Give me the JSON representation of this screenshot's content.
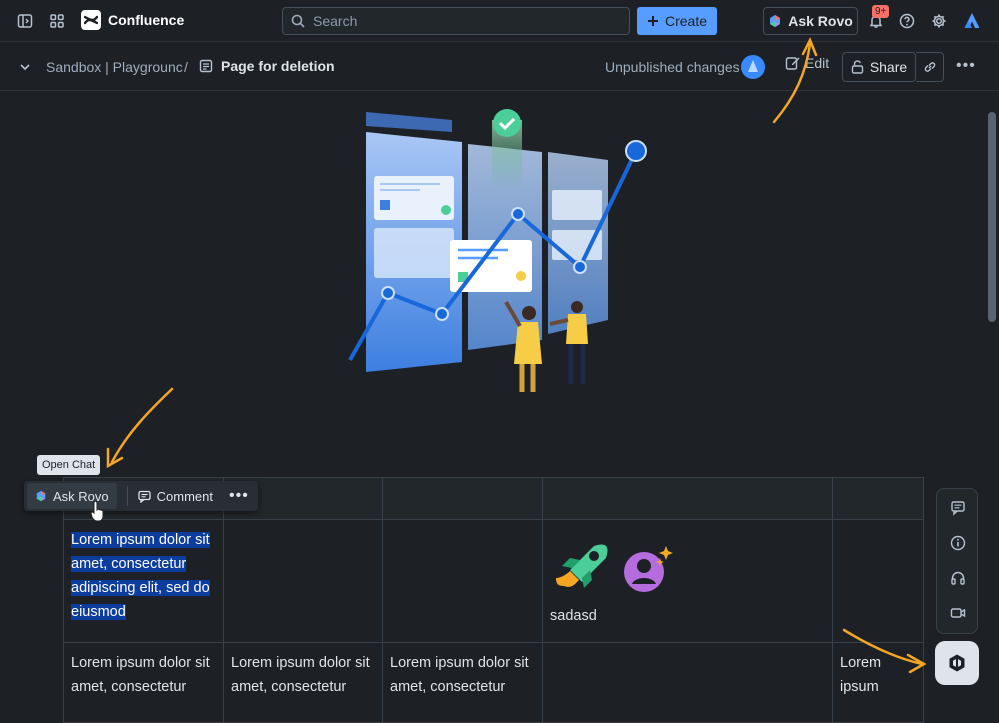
{
  "topbar": {
    "app_name": "Confluence",
    "search_placeholder": "Search",
    "create_label": "Create",
    "ask_rovo_label": "Ask Rovo",
    "notifications_badge": "9+"
  },
  "subbar": {
    "breadcrumb_space": "Sandbox | Playgrounc",
    "breadcrumb_sep": "/",
    "page_title": "Page for deletion",
    "status": "Unpublished changes",
    "edit_label": "Edit",
    "share_label": "Share"
  },
  "toolbar": {
    "tooltip": "Open Chat",
    "ask_rovo_label": "Ask Rovo",
    "comment_label": "Comment"
  },
  "table": {
    "row1": {
      "c1": "Lorem ipsum dolor sit amet, consectetur adipiscing elit, sed do eiusmod",
      "c4": "sadasd"
    },
    "row2": {
      "c1": "Lorem ipsum dolor sit amet, consectetur",
      "c2": "Lorem ipsum dolor sit amet, consectetur",
      "c3": "Lorem ipsum dolor sit amet, consectetur",
      "c5": "Lorem ipsum"
    }
  },
  "colors": {
    "accent": "#579dff",
    "selection": "#0c3c9e",
    "annotation_arrow": "#f5a623"
  }
}
